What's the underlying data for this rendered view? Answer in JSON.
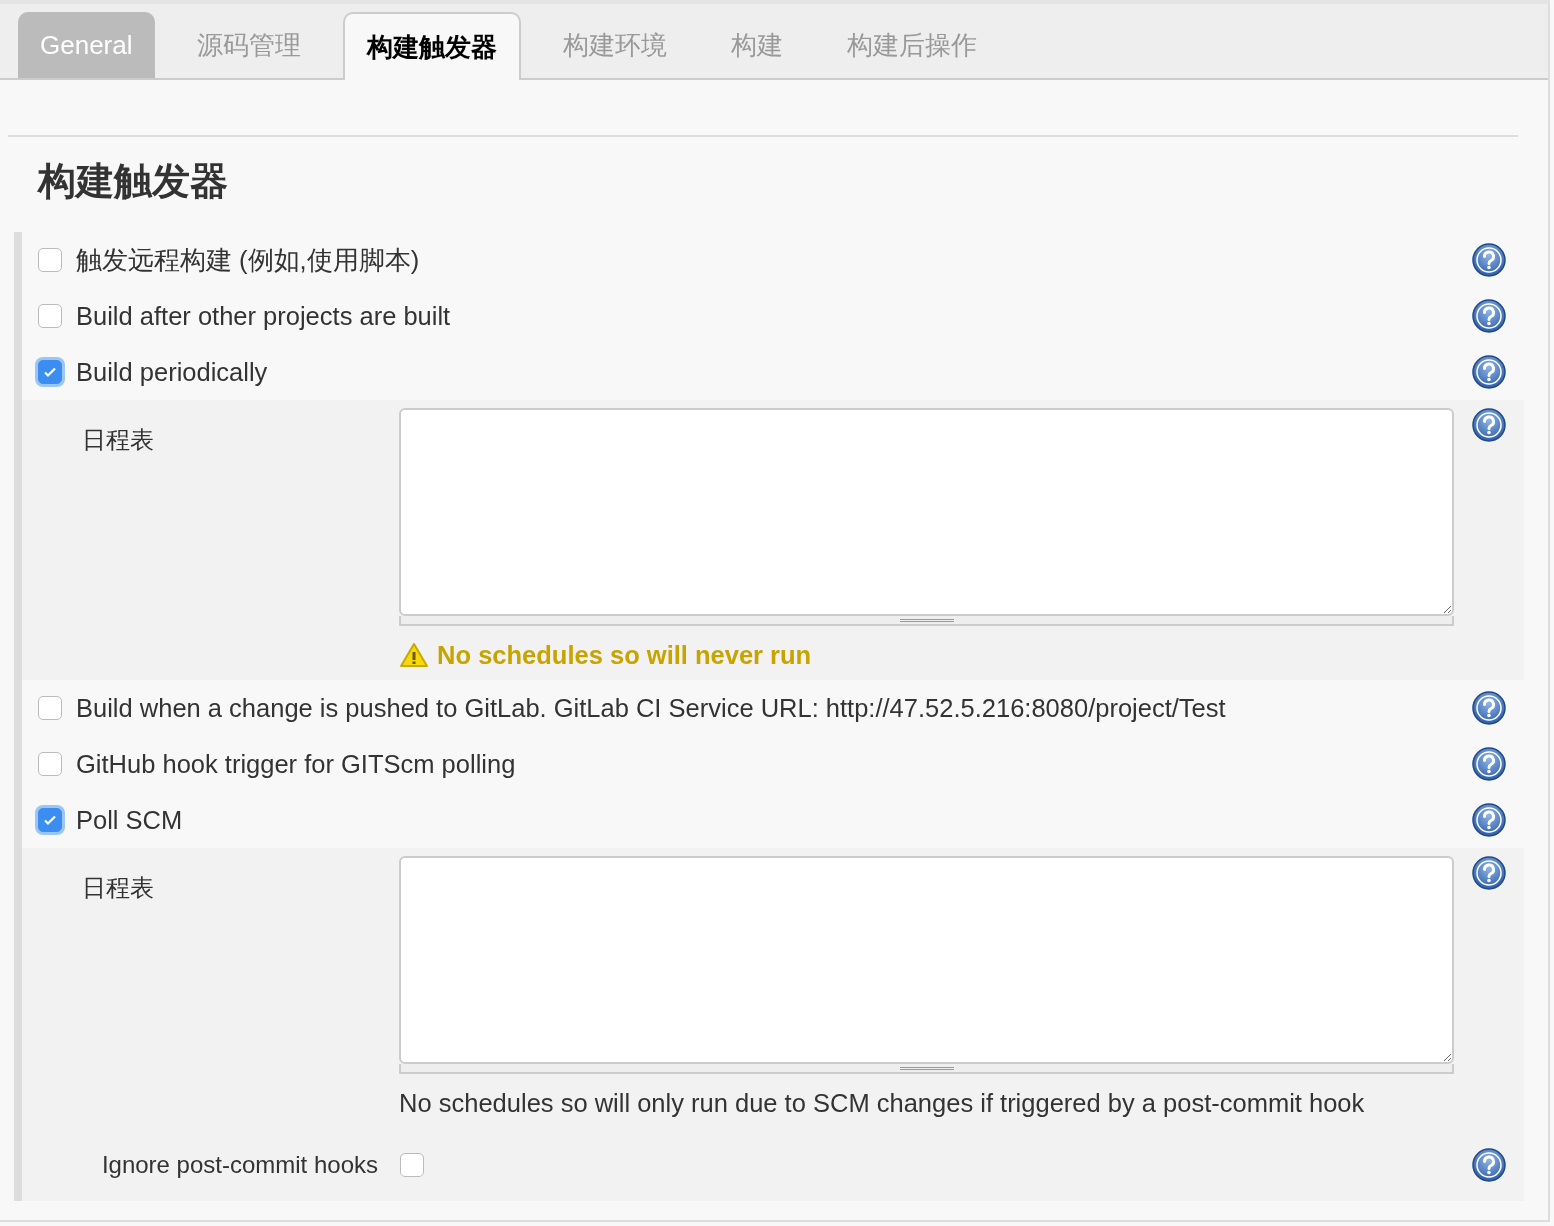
{
  "tabs": [
    {
      "label": "General",
      "selected": false,
      "hovered": true
    },
    {
      "label": "源码管理",
      "selected": false,
      "hovered": false
    },
    {
      "label": "构建触发器",
      "selected": true,
      "hovered": false
    },
    {
      "label": "构建环境",
      "selected": false,
      "hovered": false
    },
    {
      "label": "构建",
      "selected": false,
      "hovered": false
    },
    {
      "label": "构建后操作",
      "selected": false,
      "hovered": false
    }
  ],
  "section_title": "构建触发器",
  "triggers": [
    {
      "label": "触发远程构建 (例如,使用脚本)",
      "checked": false
    },
    {
      "label": "Build after other projects are built",
      "checked": false
    },
    {
      "label": "Build periodically",
      "checked": true,
      "schedule": {
        "label": "日程表",
        "message": {
          "kind": "warning",
          "text": "No schedules so will never run"
        }
      }
    },
    {
      "label": "Build when a change is pushed to GitLab. GitLab CI Service URL: http://47.52.5.216:8080/project/Test",
      "checked": false
    },
    {
      "label": "GitHub hook trigger for GITScm polling",
      "checked": false
    },
    {
      "label": "Poll SCM",
      "checked": true,
      "schedule": {
        "label": "日程表",
        "message": {
          "kind": "info",
          "text": "No schedules so will only run due to SCM changes if triggered by a post-commit hook"
        }
      },
      "options": [
        {
          "label": "Ignore post-commit hooks",
          "checked": false
        }
      ]
    }
  ]
}
